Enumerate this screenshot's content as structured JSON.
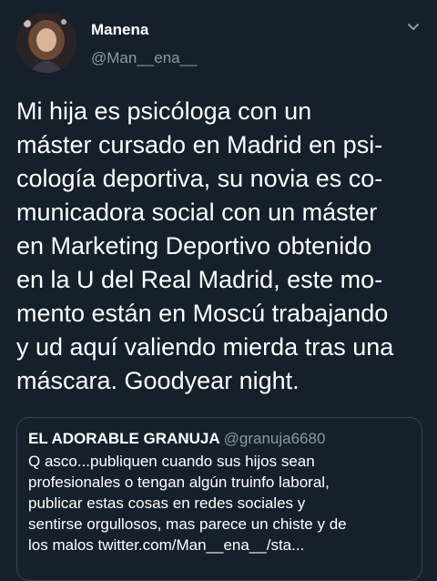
{
  "tweet": {
    "author_name": "Manena",
    "author_handle": "@Man__ena__",
    "text": "Mi hija es psicóloga con un\nmáster cursado en Madrid en psi-\ncología deportiva, su novia es co-\nmunicadora social con un máster\nen Marketing Deportivo obtenido\nen la U del Real Madrid, este mo-\nmento están en Moscú trabajando\ny ud aquí valiendo mierda tras una\nmáscara. Goodyear night."
  },
  "quoted": {
    "author_name": "EL ADORABLE GRANUJA",
    "author_handle": "@granuja6680",
    "text": "Q asco...publiquen cuando sus hijos sean\nprofesionales o tengan algún truinfo laboral,\npublicar estas cosas en redes sociales y\nsentirse orgullosos, mas parece un chiste y de\nlos malos twitter.com/Man__ena__/sta..."
  },
  "icons": {
    "menu": "chevron-down-icon",
    "avatar": "profile-photo"
  },
  "colors": {
    "background": "#15202b",
    "text": "#ffffff",
    "secondary_text": "#8899a6",
    "border": "#38444d"
  }
}
